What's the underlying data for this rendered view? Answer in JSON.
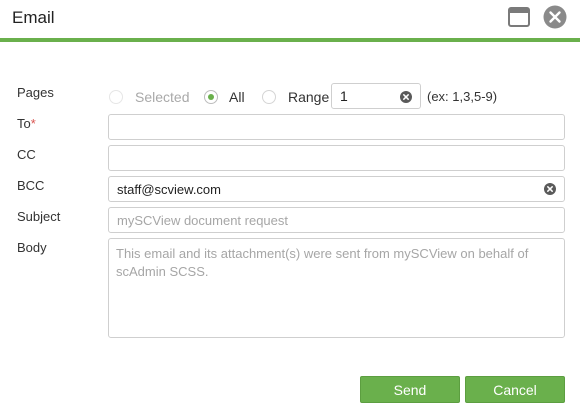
{
  "dialog": {
    "title": "Email",
    "accent_color": "#6ab04c",
    "maximize_icon": "maximize-icon",
    "close_icon": "close-icon"
  },
  "form": {
    "pages": {
      "label": "Pages",
      "options": [
        {
          "label": "Selected",
          "checked": false,
          "disabled": true
        },
        {
          "label": "All",
          "checked": true,
          "disabled": false
        },
        {
          "label": "Range",
          "checked": false,
          "disabled": false
        }
      ],
      "range_value": "1",
      "range_hint": "(ex: 1,3,5-9)"
    },
    "to": {
      "label": "To",
      "required_marker": "*",
      "value": ""
    },
    "cc": {
      "label": "CC",
      "value": ""
    },
    "bcc": {
      "label": "BCC",
      "value": "staff@scview.com"
    },
    "subject": {
      "label": "Subject",
      "placeholder": "mySCView document request"
    },
    "body": {
      "label": "Body",
      "placeholder": "This email and its attachment(s) were sent from mySCView on behalf of scAdmin SCSS."
    }
  },
  "actions": {
    "send_label": "Send",
    "cancel_label": "Cancel"
  }
}
